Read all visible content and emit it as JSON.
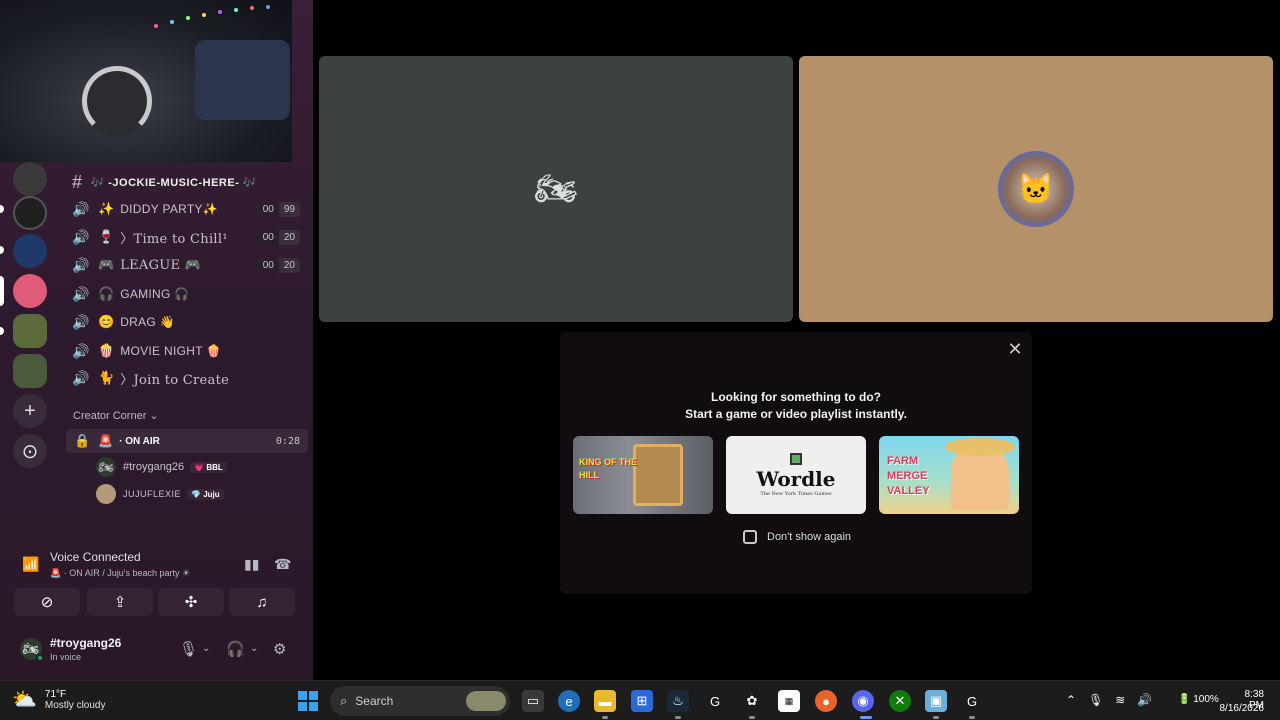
{
  "channel_list": {
    "text_channel": "🎶 -JOCKIE-MUSIC-HERE- 🎶",
    "voice_channels": [
      {
        "emoji": "✨",
        "label": "DIDDY PARTY✨",
        "count_a": "00",
        "count_b": "99",
        "serif": false
      },
      {
        "emoji": "🍷",
        "label": "〉Time to Chill¹",
        "count_a": "00",
        "count_b": "20",
        "serif": true
      },
      {
        "emoji": "🎮",
        "label": "LEAGUE 🎮",
        "count_a": "00",
        "count_b": "20",
        "serif": true
      },
      {
        "emoji": "🎧",
        "label": "GAMING 🎧",
        "count_a": "",
        "count_b": "",
        "serif": false
      },
      {
        "emoji": "😊",
        "label": "DRAG 👋",
        "count_a": "",
        "count_b": "",
        "serif": false
      },
      {
        "emoji": "🍿",
        "label": "MOVIE NIGHT 🍿",
        "count_a": "",
        "count_b": "",
        "serif": false
      },
      {
        "emoji": "🐈",
        "label": "〉Join to Create",
        "count_a": "",
        "count_b": "",
        "serif": true
      }
    ],
    "category": "Creator Corner ⌄",
    "active_channel": {
      "label": "· ON AIR",
      "time": "0:28"
    },
    "members": [
      {
        "name": "#troygang26",
        "tag": "💗 BBL"
      },
      {
        "name": "JUJUFLEXIE",
        "tag": "💎 Juju"
      }
    ]
  },
  "voice_panel": {
    "title": "Voice Connected",
    "subtitle": "🚨 · ON AIR / Juju's beach party ☀"
  },
  "user_panel": {
    "username": "#troygang26",
    "status": "In voice"
  },
  "activity_prompt": {
    "heading1": "Looking for something to do?",
    "heading2": "Start a game or video playlist instantly.",
    "games": [
      {
        "title": "KING OF THE HILL"
      },
      {
        "title": "Wordle",
        "subtitle": "The New York Times Games"
      },
      {
        "title": "FARM MERGE VALLEY"
      }
    ],
    "checkbox_label": "Don't show again"
  },
  "taskbar": {
    "weather_temp": "71°F",
    "weather_desc": "Mostly cloudy",
    "search_label": "Search",
    "battery": "100%",
    "time": "8:38 PM",
    "date": "8/16/2026"
  },
  "colors": {
    "sidebar_bg": "#2e1a2e",
    "tile1_bg": "#3c433e",
    "tile2_bg": "#b5916a",
    "taskbar_bg": "#1c1c1c",
    "accent": "#5865f2"
  }
}
